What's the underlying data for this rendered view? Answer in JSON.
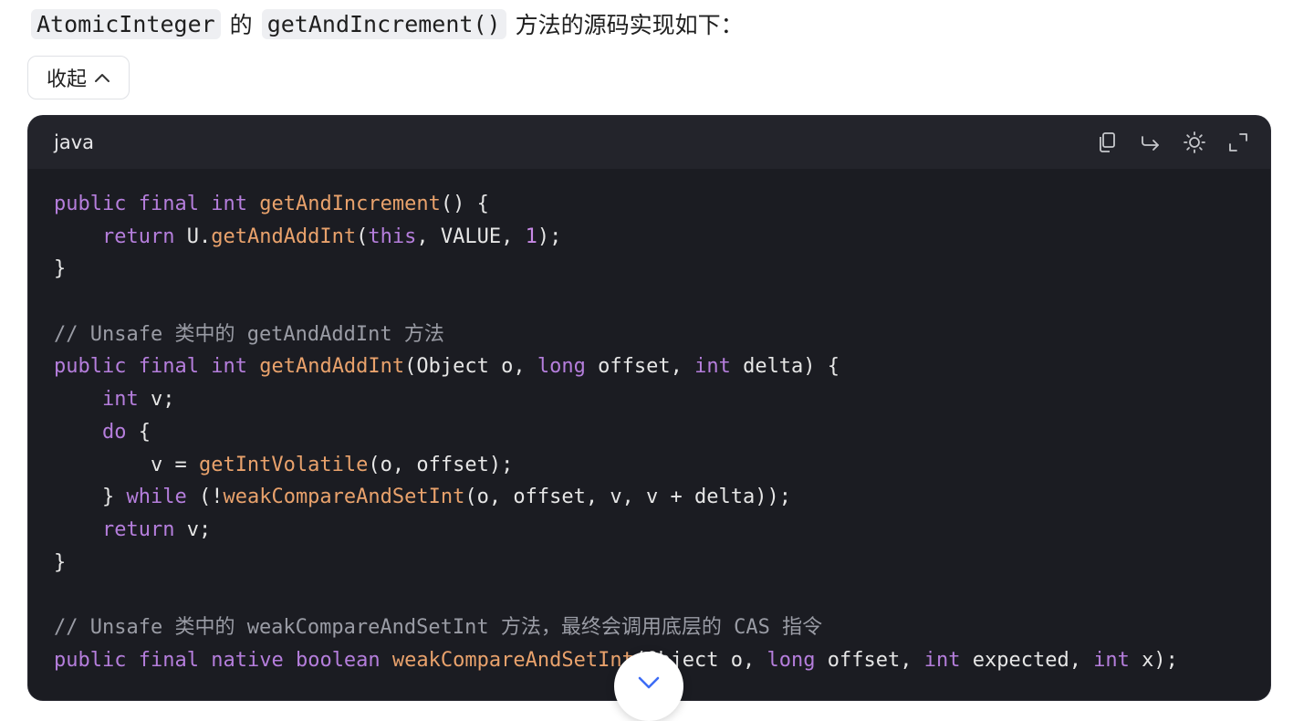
{
  "intro": {
    "code1": "AtomicInteger",
    "text1": "的",
    "code2": "getAndIncrement()",
    "text2": "方法的源码实现如下："
  },
  "collapse_button": {
    "label": "收起",
    "icon": "chevron-up-icon"
  },
  "code_block": {
    "language": "java",
    "toolbar_icons": [
      "copy-icon",
      "wrap-icon",
      "theme-icon",
      "fullscreen-icon"
    ],
    "colors": {
      "background": "#1b1c22",
      "header": "#23242b",
      "keyword": "#b57edc",
      "function": "#e9a26c",
      "comment": "#9a9ca5",
      "text": "#e6e6e6"
    },
    "lines": [
      [
        {
          "t": "public",
          "c": "kw"
        },
        {
          "t": " ",
          "c": "pl"
        },
        {
          "t": "final",
          "c": "kw"
        },
        {
          "t": " ",
          "c": "pl"
        },
        {
          "t": "int",
          "c": "kw"
        },
        {
          "t": " ",
          "c": "pl"
        },
        {
          "t": "getAndIncrement",
          "c": "fn"
        },
        {
          "t": "() {",
          "c": "pl"
        }
      ],
      [
        {
          "t": "    ",
          "c": "pl"
        },
        {
          "t": "return",
          "c": "kw"
        },
        {
          "t": " U.",
          "c": "pl"
        },
        {
          "t": "getAndAddInt",
          "c": "fn"
        },
        {
          "t": "(",
          "c": "pl"
        },
        {
          "t": "this",
          "c": "kw"
        },
        {
          "t": ", VALUE, ",
          "c": "pl"
        },
        {
          "t": "1",
          "c": "num"
        },
        {
          "t": ");",
          "c": "pl"
        }
      ],
      [
        {
          "t": "}",
          "c": "pl"
        }
      ],
      [],
      [
        {
          "t": "// Unsafe 类中的 getAndAddInt 方法",
          "c": "cm"
        }
      ],
      [
        {
          "t": "public",
          "c": "kw"
        },
        {
          "t": " ",
          "c": "pl"
        },
        {
          "t": "final",
          "c": "kw"
        },
        {
          "t": " ",
          "c": "pl"
        },
        {
          "t": "int",
          "c": "kw"
        },
        {
          "t": " ",
          "c": "pl"
        },
        {
          "t": "getAndAddInt",
          "c": "fn"
        },
        {
          "t": "(Object o, ",
          "c": "pl"
        },
        {
          "t": "long",
          "c": "kw"
        },
        {
          "t": " offset, ",
          "c": "pl"
        },
        {
          "t": "int",
          "c": "kw"
        },
        {
          "t": " delta) {",
          "c": "pl"
        }
      ],
      [
        {
          "t": "    ",
          "c": "pl"
        },
        {
          "t": "int",
          "c": "kw"
        },
        {
          "t": " v;",
          "c": "pl"
        }
      ],
      [
        {
          "t": "    ",
          "c": "pl"
        },
        {
          "t": "do",
          "c": "kw"
        },
        {
          "t": " {",
          "c": "pl"
        }
      ],
      [
        {
          "t": "        v = ",
          "c": "pl"
        },
        {
          "t": "getIntVolatile",
          "c": "fn"
        },
        {
          "t": "(o, offset);",
          "c": "pl"
        }
      ],
      [
        {
          "t": "    } ",
          "c": "pl"
        },
        {
          "t": "while",
          "c": "kw"
        },
        {
          "t": " (!",
          "c": "pl"
        },
        {
          "t": "weakCompareAndSetInt",
          "c": "fn"
        },
        {
          "t": "(o, offset, v, v + delta));",
          "c": "pl"
        }
      ],
      [
        {
          "t": "    ",
          "c": "pl"
        },
        {
          "t": "return",
          "c": "kw"
        },
        {
          "t": " v;",
          "c": "pl"
        }
      ],
      [
        {
          "t": "}",
          "c": "pl"
        }
      ],
      [],
      [
        {
          "t": "// Unsafe 类中的 weakCompareAndSetInt 方法，最终会调用底层的 CAS 指令",
          "c": "cm"
        }
      ],
      [
        {
          "t": "public",
          "c": "kw"
        },
        {
          "t": " ",
          "c": "pl"
        },
        {
          "t": "final",
          "c": "kw"
        },
        {
          "t": " ",
          "c": "pl"
        },
        {
          "t": "native",
          "c": "kw"
        },
        {
          "t": " ",
          "c": "pl"
        },
        {
          "t": "boolean",
          "c": "kw"
        },
        {
          "t": " ",
          "c": "pl"
        },
        {
          "t": "weakCompareAndSetInt",
          "c": "fn"
        },
        {
          "t": "(Object o, ",
          "c": "pl"
        },
        {
          "t": "long",
          "c": "kw"
        },
        {
          "t": " offset, ",
          "c": "pl"
        },
        {
          "t": "int",
          "c": "kw"
        },
        {
          "t": " expected, ",
          "c": "pl"
        },
        {
          "t": "int",
          "c": "kw"
        },
        {
          "t": " x);",
          "c": "pl"
        }
      ]
    ]
  },
  "scroll_button": {
    "icon": "chevron-down-icon"
  }
}
